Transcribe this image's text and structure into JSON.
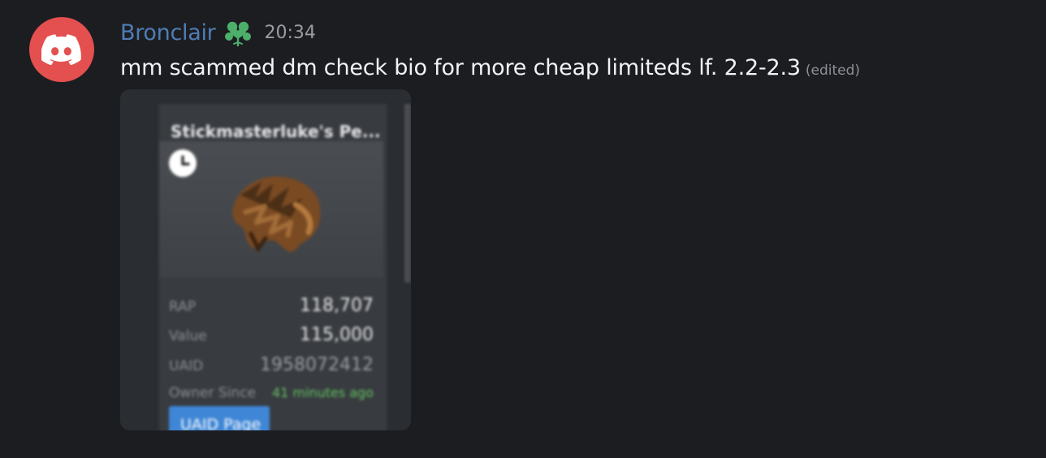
{
  "message": {
    "username": "Bronclair",
    "role_icon": "clover-icon",
    "timestamp": "20:34",
    "content": "mm scammed dm check bio for more cheap limiteds lf. 2.2-2.3",
    "edited_label": "(edited)"
  },
  "avatar": {
    "icon": "discord-logo-icon",
    "background": "#e4504f"
  },
  "colors": {
    "background": "#1c1d21",
    "username": "#4f7db4",
    "role_icon": "#4caf6a",
    "owner_since": "#63c262",
    "button": "#3f86d6"
  },
  "attachment": {
    "card_title": "Stickmasterluke's Pe...",
    "clock_icon": "clock-icon",
    "stats": [
      {
        "label": "RAP",
        "value": "118,707"
      },
      {
        "label": "Value",
        "value": "115,000"
      },
      {
        "label": "UAID",
        "value": "1958072412"
      },
      {
        "label": "Owner Since",
        "value": "41 minutes ago"
      }
    ],
    "button_label": "UAID Page"
  }
}
